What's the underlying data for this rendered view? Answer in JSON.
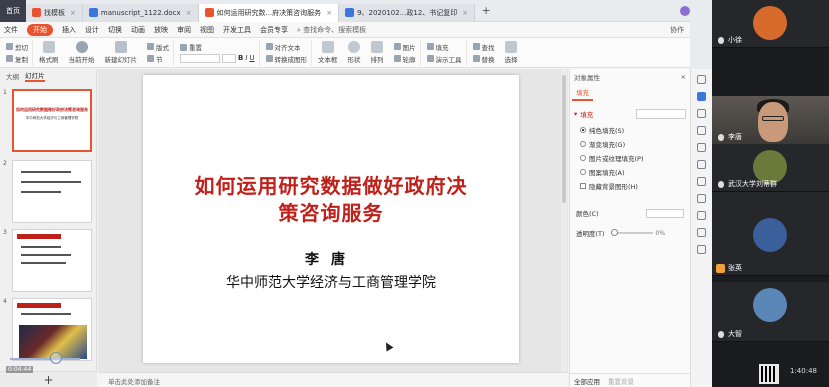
{
  "tabs": {
    "home": "首页",
    "items": [
      {
        "label": "找模板",
        "color": "#e8542f",
        "active": false
      },
      {
        "label": "manuscript_1122.docx",
        "color": "#3c76d8",
        "active": false
      },
      {
        "label": "如何运用研究数...府决策咨询服务",
        "color": "#e8542f",
        "active": true
      },
      {
        "label": "9、2020102...政12、书记复印",
        "color": "#3c76d8",
        "active": false
      }
    ],
    "add": "+"
  },
  "menu": {
    "file": "文件",
    "start": "开始",
    "items": [
      "插入",
      "设计",
      "切换",
      "动画",
      "放映",
      "审阅",
      "视图",
      "开发工具",
      "会员专享"
    ],
    "search_placeholder": "查找命令、搜索模板",
    "right": [
      "协作",
      "分享"
    ]
  },
  "toolbar": {
    "cut": "剪切",
    "copy": "复制",
    "format_painter": "格式刷",
    "paste": "粘贴",
    "from_start": "当前开始",
    "new_slide": "新建幻灯片",
    "layout": "版式",
    "section": "节",
    "reset": "重置",
    "align_text": "对齐文本",
    "convert_smartart": "转换成图形",
    "textbox": "文本框",
    "shape": "形状",
    "arrange": "排列",
    "picture": "图片",
    "fill": "填充",
    "outline": "轮廓",
    "presenter_tools": "演示工具",
    "find": "查找",
    "replace": "替换",
    "select": "选择"
  },
  "left_panel": {
    "tabs": [
      "大纲",
      "幻灯片"
    ],
    "slides": [
      {
        "num": "1",
        "title": "如何运用研究数据做好政府决策咨询服务",
        "subtitle": "华中师范大学经济与工商管理学院"
      },
      {
        "num": "2",
        "title": "",
        "subtitle": ""
      },
      {
        "num": "3",
        "title": "",
        "subtitle": ""
      },
      {
        "num": "4",
        "title": "",
        "subtitle": ""
      }
    ],
    "add_button": "+",
    "video_time": "0:04:44"
  },
  "slide": {
    "title_line1": "如何运用研究数据做好政府决",
    "title_line2": "策咨询服务",
    "author": "李唐",
    "institution": "华中师范大学经济与工商管理学院"
  },
  "notes_placeholder": "单击此处添加备注",
  "properties": {
    "header": "对象属性",
    "tab": "填充",
    "section": "填充",
    "options": [
      {
        "label": "纯色填充(S)",
        "selected": true
      },
      {
        "label": "渐变填充(G)",
        "selected": false
      },
      {
        "label": "图片或纹理填充(P)",
        "selected": false
      },
      {
        "label": "图案填充(A)",
        "selected": false
      }
    ],
    "hide_bg": "隐藏背景图形(H)",
    "color_label": "颜色(C)",
    "transparency_label": "透明度(T)",
    "transparency_value": "0%",
    "footer": [
      "全部应用",
      "重置背景"
    ]
  },
  "participants": [
    {
      "name": "小徐",
      "avatar_color": "#d76b2c"
    },
    {
      "name": "李唐",
      "camera": true
    },
    {
      "name": "武汉大学刘蒂群",
      "avatar_color": "#6a7a3a"
    },
    {
      "name": "张英",
      "avatar_color": "#3b5f9a",
      "host": true
    },
    {
      "name": "大智",
      "avatar_color": "#5b86b8"
    }
  ],
  "clock": "1:40:48"
}
